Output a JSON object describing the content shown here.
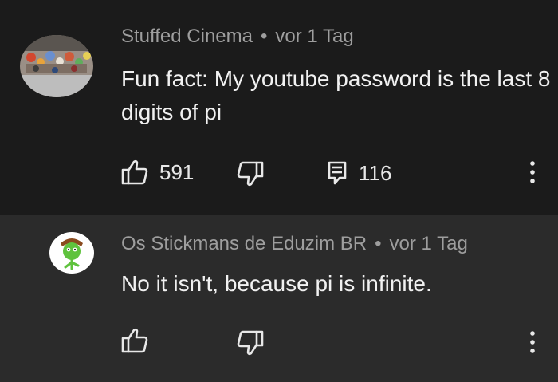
{
  "comments": [
    {
      "author": "Stuffed Cinema",
      "separator": "•",
      "time": "vor 1 Tag",
      "text": "Fun fact: My youtube password is the last 8 digits of pi",
      "like_count": "591",
      "reply_count": "116"
    },
    {
      "author": "Os Stickmans de Eduzim BR",
      "separator": "•",
      "time": "vor 1 Tag",
      "text": "No it isn't, because pi is infinite."
    }
  ],
  "colors": {
    "bg_primary": "#1b1b1b",
    "bg_reply": "#2b2b2b",
    "meta_text": "#9e9e9e",
    "body_text": "#f1f1f1"
  }
}
